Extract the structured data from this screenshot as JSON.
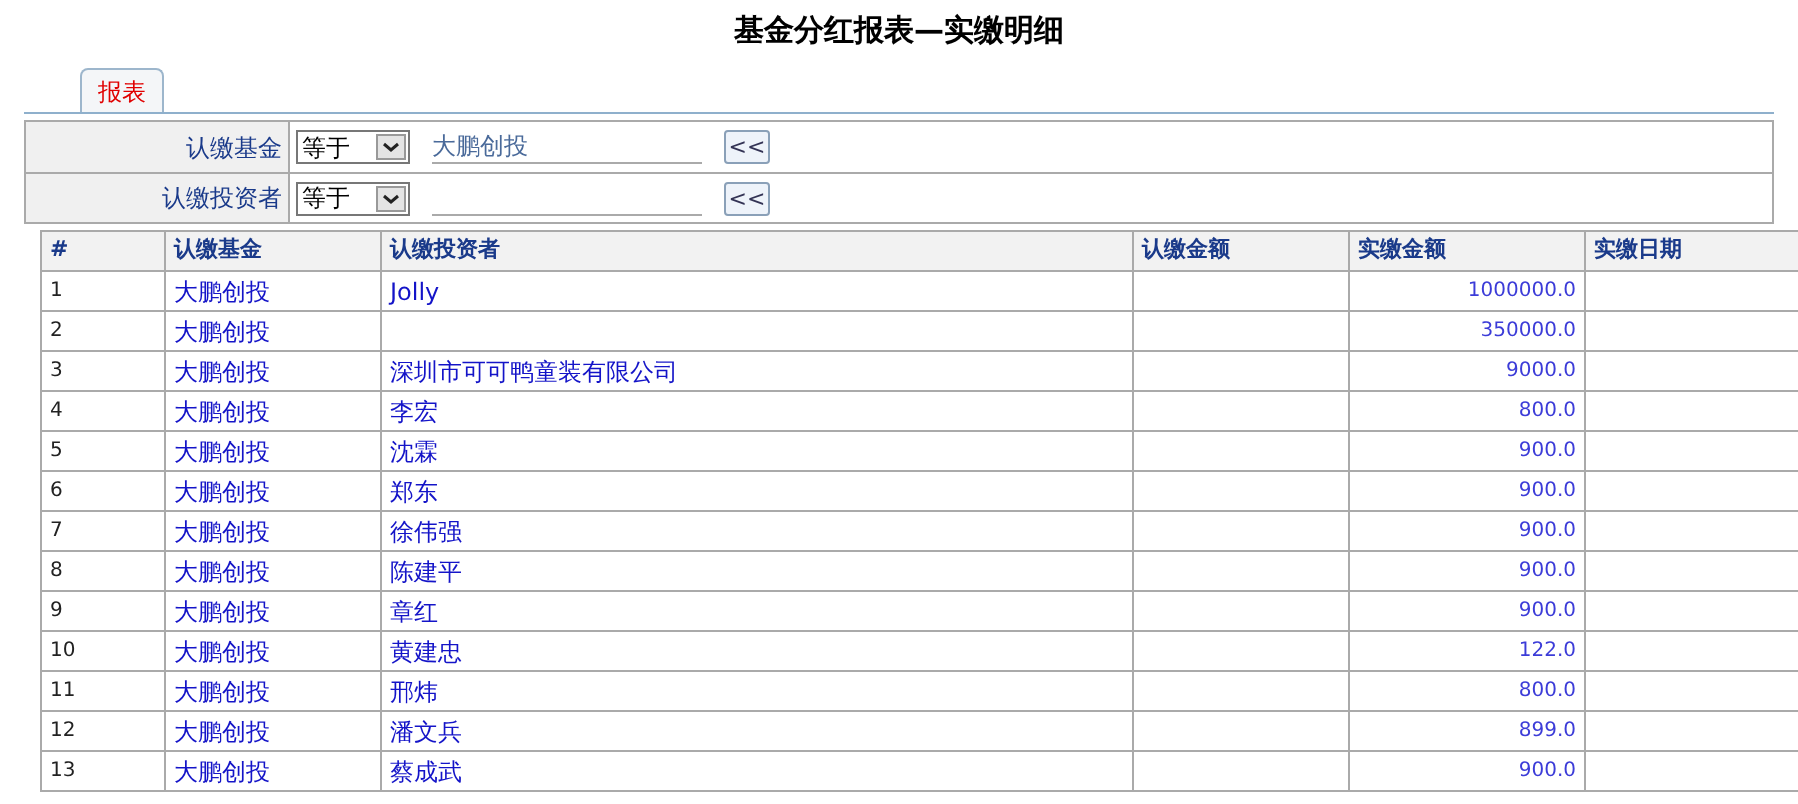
{
  "title": "基金分红报表—实缴明细",
  "tabs": [
    {
      "label": "报表",
      "selected": true
    }
  ],
  "filters": [
    {
      "label": "认缴基金",
      "operator": "等于",
      "value": "大鹏创投",
      "button": "<<"
    },
    {
      "label": "认缴投资者",
      "operator": "等于",
      "button": "<<"
    }
  ],
  "table": {
    "columns": [
      "#",
      "认缴基金",
      "认缴投资者",
      "认缴金额",
      "实缴金额",
      "实缴日期"
    ],
    "rows": [
      {
        "no": "1",
        "fund": "大鹏创投",
        "investor": "Jolly",
        "paid": "1000000.0"
      },
      {
        "no": "2",
        "fund": "大鹏创投",
        "paid": "350000.0"
      },
      {
        "no": "3",
        "fund": "大鹏创投",
        "investor": "深圳市可可鸭童装有限公司",
        "paid": "9000.0"
      },
      {
        "no": "4",
        "fund": "大鹏创投",
        "investor": "李宏",
        "paid": "800.0"
      },
      {
        "no": "5",
        "fund": "大鹏创投",
        "investor": "沈霖",
        "paid": "900.0"
      },
      {
        "no": "6",
        "fund": "大鹏创投",
        "investor": "郑东",
        "paid": "900.0"
      },
      {
        "no": "7",
        "fund": "大鹏创投",
        "investor": "徐伟强",
        "paid": "900.0"
      },
      {
        "no": "8",
        "fund": "大鹏创投",
        "investor": "陈建平",
        "paid": "900.0"
      },
      {
        "no": "9",
        "fund": "大鹏创投",
        "investor": "章红",
        "paid": "900.0"
      },
      {
        "no": "10",
        "fund": "大鹏创投",
        "investor": "黄建忠",
        "paid": "122.0"
      },
      {
        "no": "11",
        "fund": "大鹏创投",
        "investor": "邢炜",
        "paid": "800.0"
      },
      {
        "no": "12",
        "fund": "大鹏创投",
        "investor": "潘文兵",
        "paid": "899.0"
      },
      {
        "no": "13",
        "fund": "大鹏创投",
        "investor": "蔡成武",
        "paid": "900.0"
      }
    ]
  }
}
